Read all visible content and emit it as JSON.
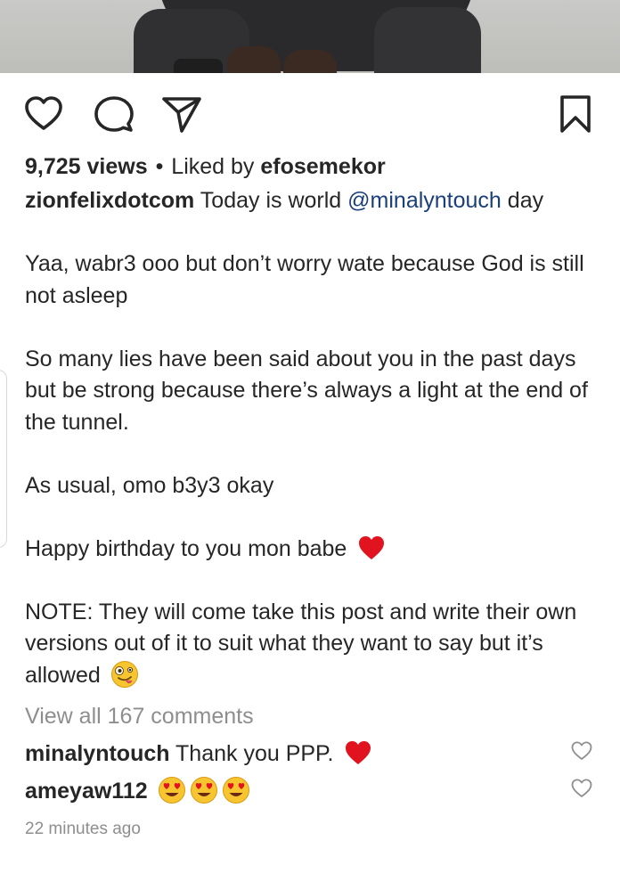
{
  "actions": {
    "like_icon": "heart-outline",
    "comment_icon": "speech-bubble",
    "share_icon": "paper-plane",
    "save_icon": "bookmark"
  },
  "meta": {
    "views": "9,725 views",
    "separator": "•",
    "liked_by_prefix": "Liked by",
    "liked_by_user": "efosemekor"
  },
  "caption": {
    "username": "zionfelixdotcom",
    "line1_text": "Today is world",
    "mention": "@minalyntouch",
    "line1_suffix": "day",
    "para2": "Yaa, wabr3 ooo but don’t worry wate because God is still not asleep",
    "para3": "So many lies have been said about you in the past days but be strong because there’s always a light at the end of the tunnel.",
    "para4": "As usual, omo b3y3 okay",
    "para5": "Happy birthday to you mon babe",
    "para6": "NOTE: They will come take this post and write their own versions out of it to suit what they want to say but it’s allowed"
  },
  "view_all_comments": "View all 167 comments",
  "comments": [
    {
      "username": "minalyntouch",
      "text": "Thank you PPP."
    },
    {
      "username": "ameyaw112",
      "text": ""
    }
  ],
  "timestamp": "22 minutes ago",
  "colors": {
    "text": "#262626",
    "muted": "#8e8e8e",
    "mention": "#1a3f7a",
    "heart_red": "#e0131f"
  }
}
